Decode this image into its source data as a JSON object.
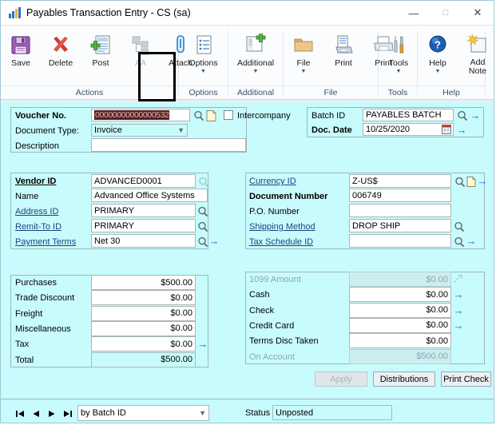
{
  "window": {
    "title": "Payables Transaction Entry  -  CS (sa)",
    "minimize": "—",
    "maximize": "☐",
    "close": "✕"
  },
  "ribbon": {
    "groups": [
      {
        "label": "Actions",
        "items": [
          {
            "label": "Save",
            "icon": "save-icon",
            "disabled": false,
            "caret": false
          },
          {
            "label": "Delete",
            "icon": "delete-icon",
            "disabled": false,
            "caret": false
          },
          {
            "label": "Post",
            "icon": "post-icon",
            "disabled": false,
            "caret": false
          },
          {
            "label": "AA",
            "icon": "aa-icon",
            "disabled": true,
            "caret": false
          },
          {
            "label": "Attach",
            "icon": "attach-icon",
            "disabled": false,
            "caret": false,
            "highlighted": true
          }
        ]
      },
      {
        "label": "Options",
        "items": [
          {
            "label": "Options",
            "icon": "options-icon",
            "disabled": false,
            "caret": true
          }
        ]
      },
      {
        "label": "Additional",
        "items": [
          {
            "label": "Additional",
            "icon": "additional-icon",
            "disabled": false,
            "caret": true
          }
        ]
      },
      {
        "label": "File",
        "items": [
          {
            "label": "File",
            "icon": "folder-icon",
            "disabled": false,
            "caret": true
          },
          {
            "label": "Print",
            "icon": "print-document-icon",
            "disabled": false,
            "caret": false
          },
          {
            "label": "Print",
            "icon": "printer-icon",
            "disabled": false,
            "caret": false
          }
        ]
      },
      {
        "label": "Tools",
        "items": [
          {
            "label": "Tools",
            "icon": "tools-icon",
            "disabled": false,
            "caret": true
          }
        ]
      },
      {
        "label": "Help",
        "items": [
          {
            "label": "Help",
            "icon": "help-icon",
            "disabled": false,
            "caret": true
          },
          {
            "label": "Add Note",
            "icon": "add-note-icon",
            "disabled": false,
            "caret": false
          }
        ]
      }
    ]
  },
  "header": {
    "voucher_no_label": "Voucher No.",
    "voucher_no_value": "00000000000000532",
    "document_type_label": "Document Type:",
    "document_type_value": "Invoice",
    "description_label": "Description",
    "description_value": "",
    "intercompany_label": "Intercompany",
    "intercompany_checked": false,
    "batch_id_label": "Batch ID",
    "batch_id_value": "PAYABLES BATCH",
    "doc_date_label": "Doc. Date",
    "doc_date_value": "10/25/2020"
  },
  "vendor": {
    "vendor_id_label": "Vendor ID",
    "vendor_id_value": "ADVANCED0001",
    "name_label": "Name",
    "name_value": "Advanced Office Systems",
    "address_id_label": "Address ID",
    "address_id_value": "PRIMARY",
    "remit_to_id_label": "Remit-To ID",
    "remit_to_id_value": "PRIMARY",
    "payment_terms_label": "Payment Terms",
    "payment_terms_value": "Net 30"
  },
  "document": {
    "currency_id_label": "Currency ID",
    "currency_id_value": "Z-US$",
    "document_number_label": "Document Number",
    "document_number_value": "006749",
    "po_number_label": "P.O. Number",
    "po_number_value": "",
    "shipping_method_label": "Shipping Method",
    "shipping_method_value": "DROP SHIP",
    "tax_schedule_id_label": "Tax Schedule ID",
    "tax_schedule_id_value": ""
  },
  "amounts": {
    "rows": [
      {
        "label": "Purchases",
        "value": "$500.00",
        "arrow": false,
        "readonly": false
      },
      {
        "label": "Trade Discount",
        "value": "$0.00",
        "arrow": false,
        "readonly": false
      },
      {
        "label": "Freight",
        "value": "$0.00",
        "arrow": false,
        "readonly": false
      },
      {
        "label": "Miscellaneous",
        "value": "$0.00",
        "arrow": false,
        "readonly": false
      },
      {
        "label": "Tax",
        "value": "$0.00",
        "arrow": true,
        "readonly": false
      },
      {
        "label": "Total",
        "value": "$500.00",
        "arrow": false,
        "readonly": true
      }
    ]
  },
  "payments": {
    "rows": [
      {
        "label": "1099 Amount",
        "value": "$0.00",
        "arrow": false,
        "disabled": true
      },
      {
        "label": "Cash",
        "value": "$0.00",
        "arrow": true,
        "disabled": false
      },
      {
        "label": "Check",
        "value": "$0.00",
        "arrow": true,
        "disabled": false
      },
      {
        "label": "Credit Card",
        "value": "$0.00",
        "arrow": true,
        "disabled": false
      },
      {
        "label": "Terms Disc Taken",
        "value": "$0.00",
        "arrow": false,
        "disabled": false
      },
      {
        "label": "On Account",
        "value": "$500.00",
        "arrow": false,
        "disabled": true
      }
    ]
  },
  "buttons": {
    "apply": "Apply",
    "distributions": "Distributions",
    "print_check": "Print Check"
  },
  "statusbar": {
    "nav_first": "⏮",
    "nav_prev": "◀",
    "nav_next": "▶",
    "nav_last": "⏭",
    "browse_by_value": "by Batch ID",
    "status_label": "Status",
    "status_value": "Unposted"
  },
  "colors": {
    "window_bg": "#c8fcfc",
    "link": "#17457e",
    "arrow_blue": "#1d64c6",
    "selection_bg": "#5a1f1f"
  }
}
